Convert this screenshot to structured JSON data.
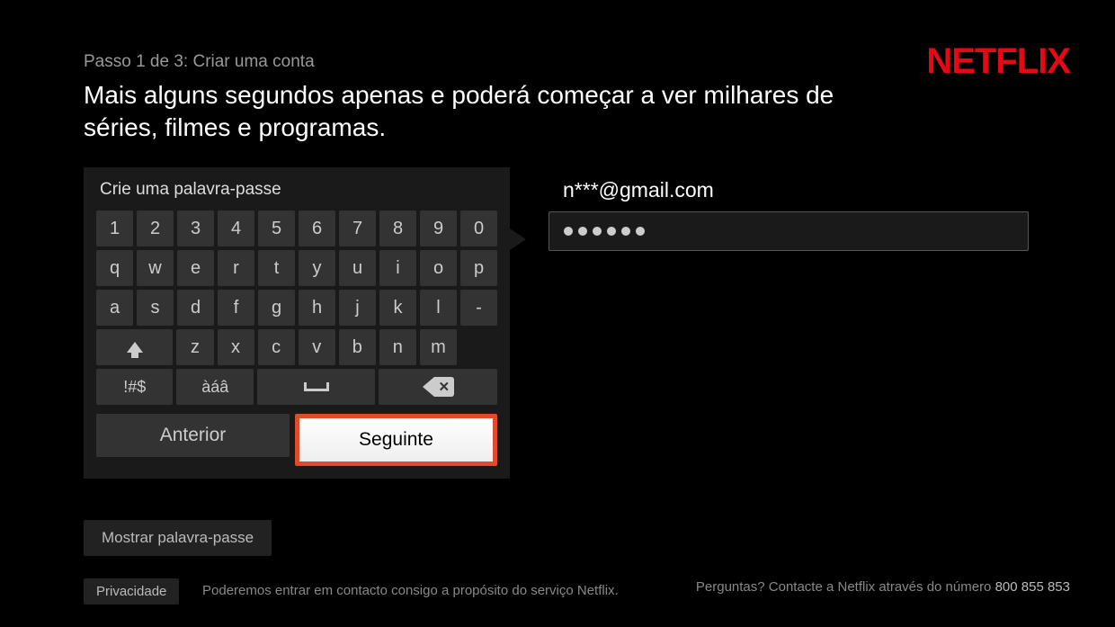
{
  "logo": "NETFLIX",
  "header": {
    "step": "Passo 1 de 3: Criar uma conta",
    "headline": "Mais alguns segundos apenas e poderá começar a ver milhares de séries, filmes e programas."
  },
  "keyboard": {
    "title": "Crie uma palavra-passe",
    "rows": [
      [
        "1",
        "2",
        "3",
        "4",
        "5",
        "6",
        "7",
        "8",
        "9",
        "0"
      ],
      [
        "q",
        "w",
        "e",
        "r",
        "t",
        "y",
        "u",
        "i",
        "o",
        "p"
      ],
      [
        "a",
        "s",
        "d",
        "f",
        "g",
        "h",
        "j",
        "k",
        "l",
        "-"
      ],
      [
        "",
        "",
        "z",
        "x",
        "c",
        "v",
        "b",
        "n",
        "m",
        ""
      ]
    ],
    "symbols_label": "!#$",
    "accents_label": "àáâ",
    "nav": {
      "previous": "Anterior",
      "next": "Seguinte"
    }
  },
  "form": {
    "email": "n***@gmail.com",
    "password_length": 6
  },
  "buttons": {
    "show_password": "Mostrar palavra-passe",
    "privacy": "Privacidade"
  },
  "footer": {
    "contact_note": "Poderemos entrar em contacto consigo a propósito do serviço Netflix.",
    "support_prefix": "Perguntas? Contacte a Netflix através do número ",
    "support_phone": "800 855 853"
  }
}
